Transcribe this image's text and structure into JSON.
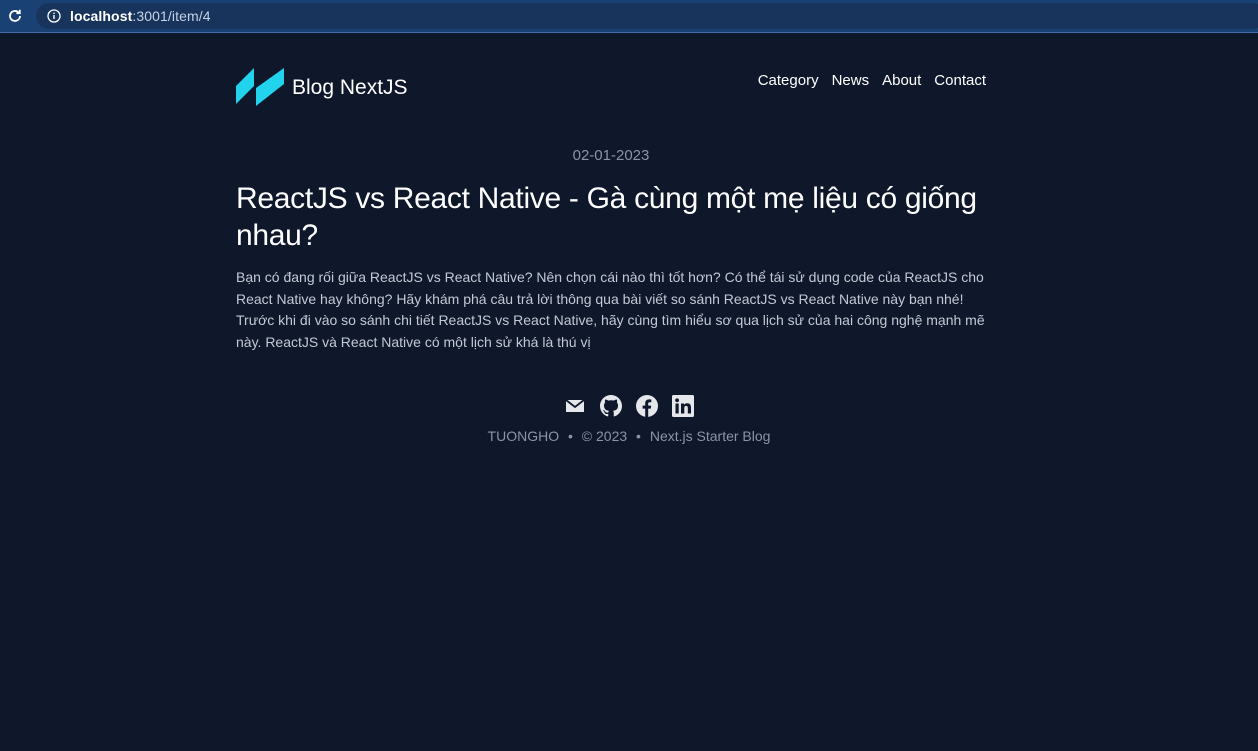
{
  "browser": {
    "url_host": "localhost",
    "url_path": ":3001/item/4"
  },
  "header": {
    "site_title": "Blog NextJS",
    "nav": [
      "Category",
      "News",
      "About",
      "Contact"
    ]
  },
  "post": {
    "date": "02-01-2023",
    "title": "ReactJS vs React Native - Gà cùng một mẹ liệu có giống nhau?",
    "excerpt": "Bạn có đang rối giữa ReactJS vs React Native? Nên chọn cái nào thì tốt hơn? Có thể tái sử dụng code của ReactJS cho React Native hay không? Hãy khám phá câu trả lời thông qua bài viết so sánh ReactJS vs React Native này bạn nhé! Trước khi đi vào so sánh chi tiết ReactJS vs React Native, hãy cùng tìm hiểu sơ qua lịch sử của hai công nghệ mạnh mẽ này. ReactJS và React Native có một lịch sử khá là thú vị"
  },
  "footer": {
    "social_icons": [
      "mail-icon",
      "github-icon",
      "facebook-icon",
      "linkedin-icon"
    ],
    "author": "TUONGHO",
    "separator": "•",
    "copyright": "© 2023",
    "credit": "Next.js Starter Blog"
  },
  "colors": {
    "background": "#0f172a",
    "browser_bar": "#1a4173",
    "logo_accent": "#22d3ee",
    "muted_text": "#8b95a6"
  }
}
